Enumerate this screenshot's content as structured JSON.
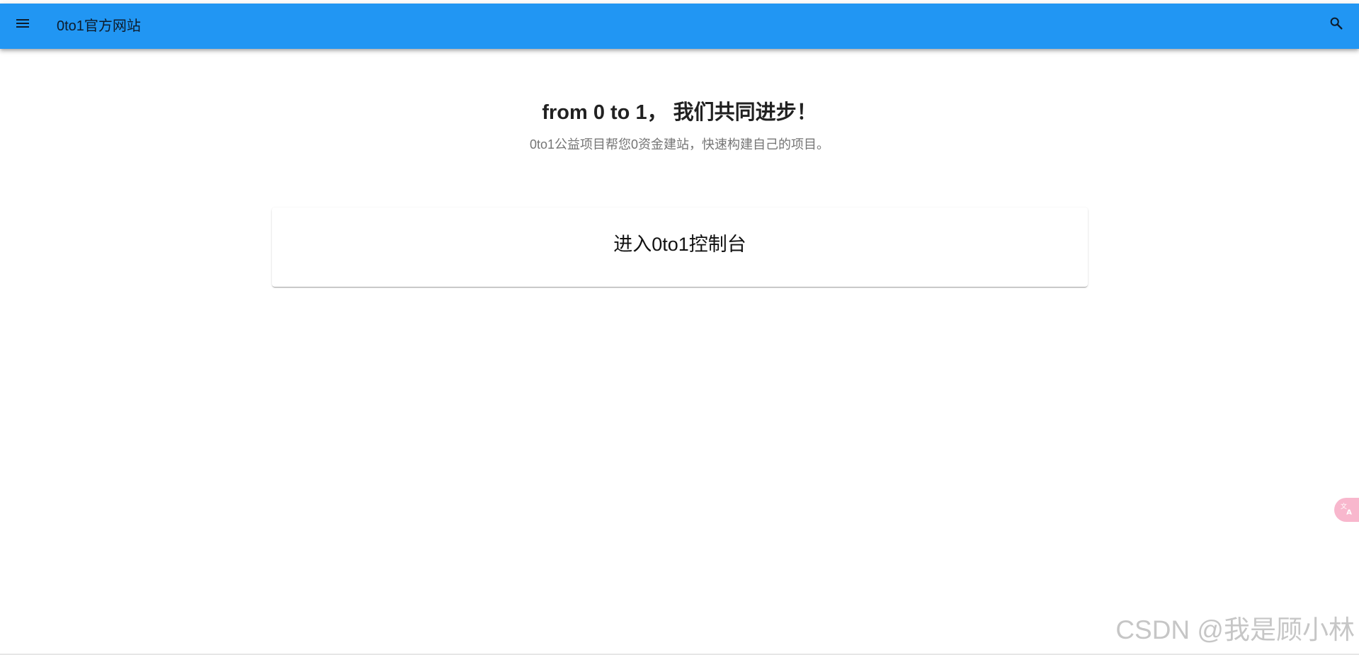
{
  "app_bar": {
    "title": "0to1官方网站",
    "menu_icon": "menu-icon",
    "search_icon": "search-icon",
    "background_color": "#2196f3"
  },
  "hero": {
    "title": "from 0 to 1， 我们共同进步！",
    "subtitle": "0to1公益项目帮您0资金建站，快速构建自己的项目。"
  },
  "console_card": {
    "label": "进入0to1控制台"
  },
  "floating": {
    "translate_icon": "translate-icon",
    "color": "#f8b7cd"
  },
  "watermark": {
    "text": "CSDN @我是顾小林"
  }
}
